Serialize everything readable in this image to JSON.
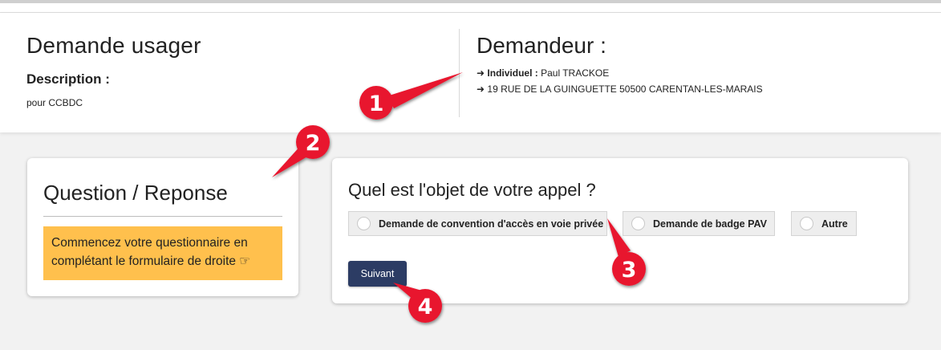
{
  "header": {
    "left_title": "Demande usager",
    "description_label": "Description :",
    "description_value": "pour CCBDC",
    "right_title": "Demandeur :",
    "arrow_glyph": "➜",
    "individual_label": "Individuel :",
    "individual_value": "Paul TRACKOE",
    "address": "19 RUE DE LA GUINGUETTE 50500 CARENTAN-LES-MARAIS"
  },
  "left_panel": {
    "title": "Question / Reponse",
    "notice": "Commencez votre questionnaire en complétant le formulaire de droite ☞"
  },
  "right_panel": {
    "question": "Quel est l'objet de votre appel ?",
    "options": [
      "Demande de convention d'accès en voie privée",
      "Demande de badge PAV",
      "Autre"
    ],
    "next_button": "Suivant"
  },
  "annotations": {
    "markers": [
      "1",
      "2",
      "3",
      "4"
    ],
    "color": "#e8162f"
  }
}
